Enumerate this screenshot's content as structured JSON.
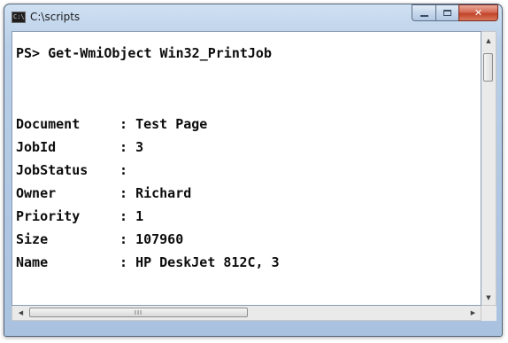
{
  "window": {
    "title": "C:\\scripts",
    "icon": "console-icon",
    "icon_glyph": "C:\\",
    "buttons": {
      "minimize": "minimize-icon",
      "maximize": "maximize-icon",
      "close": "close-icon",
      "close_glyph": "✕"
    }
  },
  "console": {
    "prompt": "PS> Get-WmiObject Win32_PrintJob",
    "properties": [
      {
        "key": "Document",
        "value": "Test Page"
      },
      {
        "key": "JobId",
        "value": "3"
      },
      {
        "key": "JobStatus",
        "value": ""
      },
      {
        "key": "Owner",
        "value": "Richard"
      },
      {
        "key": "Priority",
        "value": "1"
      },
      {
        "key": "Size",
        "value": "107960"
      },
      {
        "key": "Name",
        "value": "HP DeskJet 812C, 3"
      }
    ],
    "separator": ":"
  },
  "scrollbars": {
    "up_arrow": "▲",
    "down_arrow": "▼",
    "left_arrow": "◀",
    "right_arrow": "▶",
    "grip": "III"
  },
  "colors": {
    "console_background": "#ffffff",
    "console_text": "#0c0c0c",
    "close_button": "#c2432a"
  }
}
